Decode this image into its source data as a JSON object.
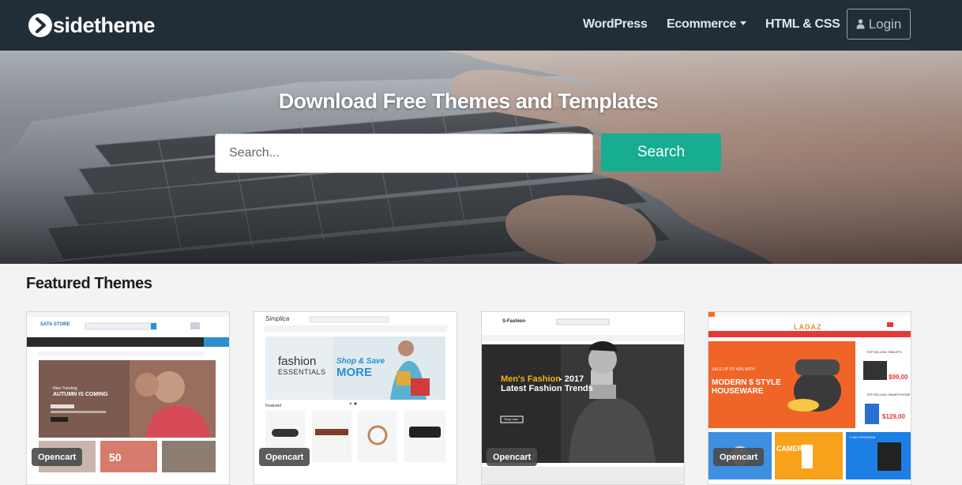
{
  "brand": {
    "name": "sidetheme"
  },
  "nav": {
    "items": [
      {
        "label": "WordPress"
      },
      {
        "label": "Ecommerce"
      },
      {
        "label": "HTML & CSS"
      }
    ],
    "login_label": "Login"
  },
  "hero": {
    "title": "Download Free Themes and Templates",
    "search_placeholder": "Search...",
    "search_button": "Search"
  },
  "featured": {
    "title": "Featured Themes",
    "cards": [
      {
        "badge": "Opencart",
        "preview": {
          "logo": "SATA STORE",
          "headline": "AUTUMN IS COMING",
          "kicker": "New Trending",
          "promo": "50"
        }
      },
      {
        "badge": "Opencart",
        "preview": {
          "logo": "Simplica",
          "banner_left": "fashion",
          "banner_left_sub": "ESSENTIALS",
          "banner_right": "Shop & Save",
          "banner_right_big": "MORE",
          "section": "Featured"
        }
      },
      {
        "badge": "Opencart",
        "preview": {
          "logo": "S-Fashion",
          "headline_a": "Men's Fashion",
          "headline_b": "- 2017",
          "headline_c": "Latest Fashion Trends",
          "cta": "Shop now"
        }
      },
      {
        "badge": "Opencart",
        "preview": {
          "logo": "LADAZ",
          "promo_a": "SALE UP TO 40% WITH",
          "promo_b": "MODERN $ STYLE",
          "promo_c": "HOUSEWARE",
          "price_a": "$99,00",
          "price_b": "$129,00",
          "side_a": "TOP SELLING TABLETS",
          "side_b": "TOP SELLING SMARTPHONE",
          "tile_camera": "CAMERA",
          "tile_pad": "1 PAD PROGRAM"
        }
      }
    ]
  },
  "colors": {
    "navbar": "#212d37",
    "accent": "#17ad90",
    "badge": "#4a4a4a"
  },
  "icons": {
    "brand": "play-chevron-icon",
    "login": "user-icon",
    "dropdown": "caret-down-icon"
  }
}
